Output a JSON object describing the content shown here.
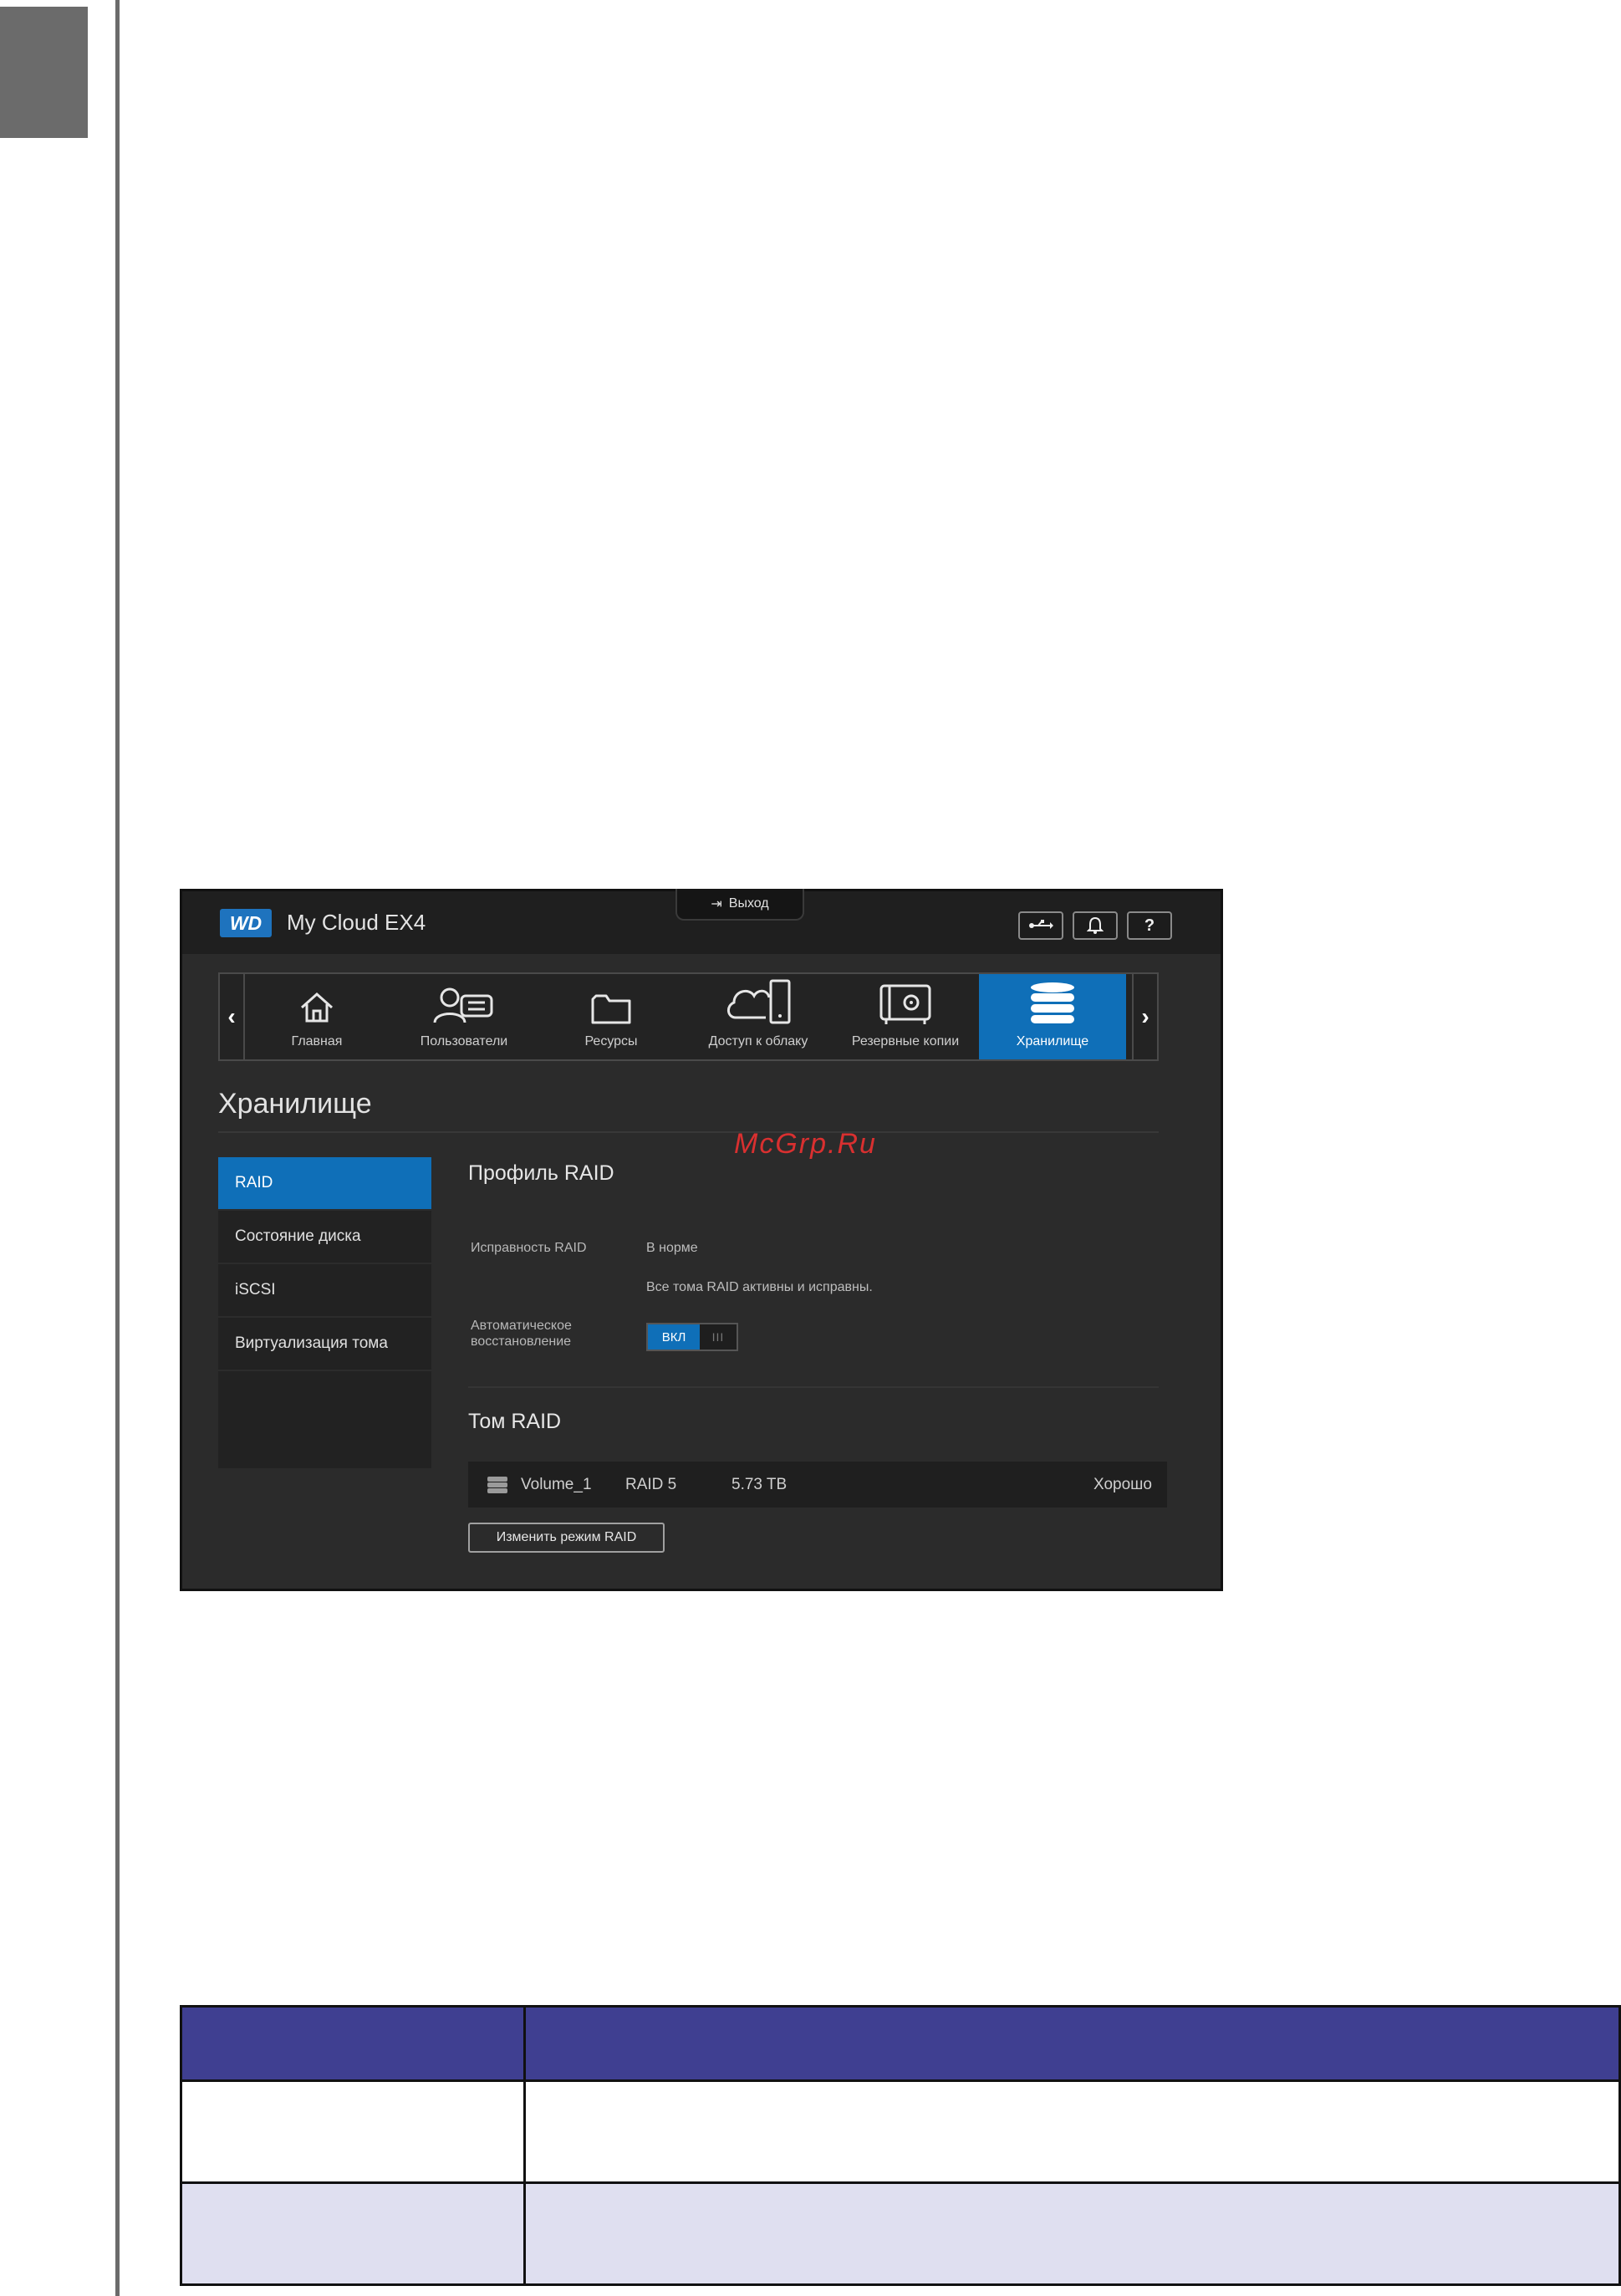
{
  "shot": {
    "brand_logo": "WD",
    "app_title": "My Cloud EX4",
    "logout_label": "Выход",
    "top_buttons": [
      {
        "icon": "usb-icon"
      },
      {
        "icon": "bell-icon"
      },
      {
        "icon": "help-icon",
        "glyph": "?"
      }
    ],
    "nav": [
      {
        "label": "Главная",
        "icon": "home-icon"
      },
      {
        "label": "Пользователи",
        "icon": "users-icon"
      },
      {
        "label": "Ресурсы",
        "icon": "folder-icon"
      },
      {
        "label": "Доступ к облаку",
        "icon": "cloud-device-icon"
      },
      {
        "label": "Резервные копии",
        "icon": "safe-icon"
      },
      {
        "label": "Хранилище",
        "icon": "storage-icon",
        "active": true
      }
    ],
    "page_title": "Хранилище",
    "sidebar": [
      "RAID",
      "Состояние диска",
      "iSCSI",
      "Виртуализация тома"
    ],
    "profile_title": "Профиль RAID",
    "health_label": "Исправность RAID",
    "health_value": "В норме",
    "health_note": "Все тома RAID активны и исправны.",
    "auto_label_1": "Автоматическое",
    "auto_label_2": "восстановление",
    "toggle_on": "ВКЛ",
    "toggle_handle": "III",
    "volume_title": "Том RAID",
    "volume": {
      "name": "Volume_1",
      "raid": "RAID 5",
      "size": "5.73 TB",
      "status": "Хорошо"
    },
    "change_raid_button": "Изменить режим RAID",
    "watermark": "McGrp.Ru"
  },
  "colors": {
    "accent": "#0f6fb8",
    "table_header": "#3f3f91",
    "table_alt_row": "#dfdff0"
  }
}
